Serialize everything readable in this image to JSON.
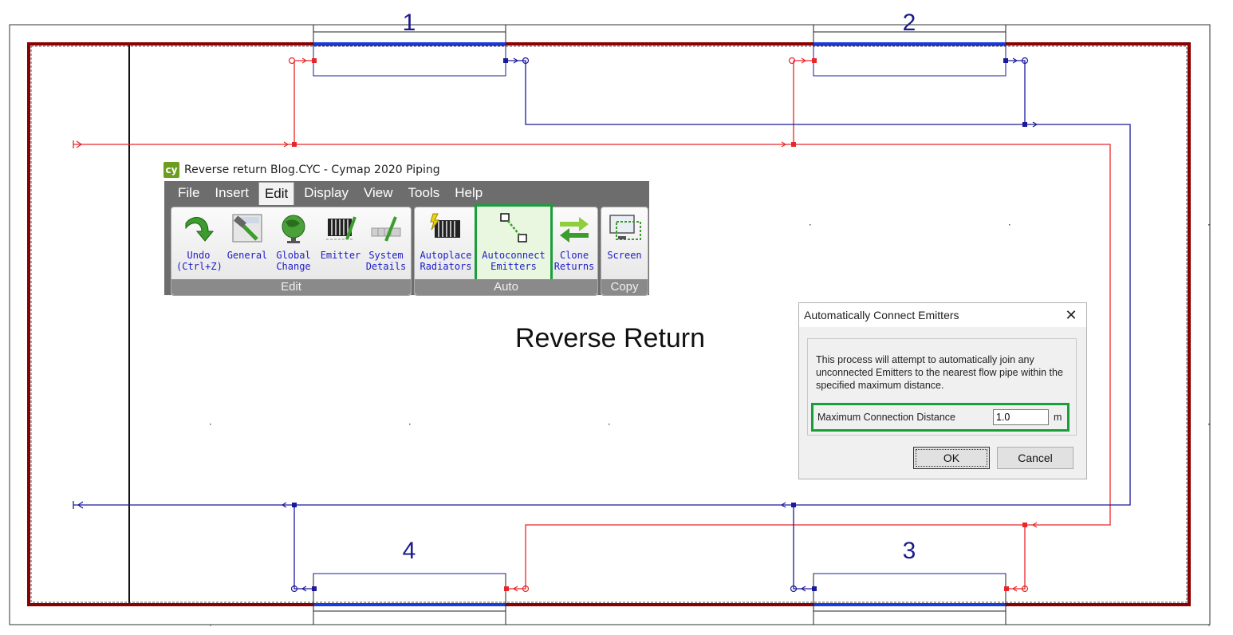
{
  "app": {
    "title": "Reverse return Blog.CYC - Cymap 2020 Piping",
    "logo": "cy"
  },
  "menu": [
    "File",
    "Insert",
    "Edit",
    "Display",
    "View",
    "Tools",
    "Help"
  ],
  "ribbon": {
    "groups": {
      "edit": "Edit",
      "auto": "Auto",
      "copy": "Copy"
    },
    "tools": {
      "undo": [
        "Undo",
        "(Ctrl+Z)"
      ],
      "general": [
        "General"
      ],
      "global_change": [
        "Global",
        "Change"
      ],
      "emitter": [
        "Emitter"
      ],
      "system_details": [
        "System",
        "Details"
      ],
      "autoplace": [
        "Autoplace",
        "Radiators"
      ],
      "autoconnect": [
        "Autoconnect",
        "Emitters"
      ],
      "clone": [
        "Clone",
        "Returns"
      ],
      "screen": [
        "Screen"
      ]
    }
  },
  "drawing": {
    "title": "Reverse Return",
    "emitters": [
      "1",
      "2",
      "3",
      "4"
    ]
  },
  "dialog": {
    "title": "Automatically Connect Emitters",
    "message": "This process will attempt to automatically join any unconnected Emitters to the nearest flow pipe within the specified maximum distance.",
    "distance_label": "Maximum Connection Distance",
    "distance_value": "1.0",
    "distance_unit": "m",
    "ok": "OK",
    "cancel": "Cancel"
  },
  "colors": {
    "flow": "#e8262a",
    "return": "#1a1a9c",
    "boundary": "#8b0000",
    "highlight": "#1a9e3a"
  }
}
